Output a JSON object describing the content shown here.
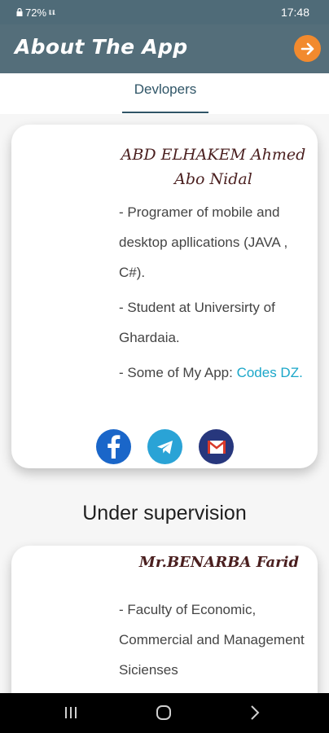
{
  "status_bar": {
    "battery": "72%",
    "signal": "lᵢl. lᵢl.",
    "time": "17:48"
  },
  "app_bar": {
    "title": "About The App",
    "next_icon": "arrow-right-icon"
  },
  "tabs": [
    {
      "label": "Devlopers",
      "selected": true
    }
  ],
  "developer": {
    "name_line1": "ABD ELHAKEM Ahmed",
    "name_line2": "Abo Nidal",
    "bullets": [
      "- Programer of mobile and desktop apllications (JAVA , C#).",
      "- Student at Universirty of Ghardaia."
    ],
    "app_prefix": "- Some of My App: ",
    "app_link": "Codes DZ.",
    "socials": [
      {
        "name": "facebook",
        "icon": "facebook-icon",
        "color": "#1a66c9"
      },
      {
        "name": "telegram",
        "icon": "telegram-icon",
        "color": "#2aa3d6"
      },
      {
        "name": "gmail",
        "icon": "mail-icon",
        "color": "#27377d"
      }
    ]
  },
  "supervision": {
    "title": "Under supervision",
    "name": "Mr.BENARBA Farid",
    "bullets": [
      "- Faculty of Economic, Commercial and Management Sicienses"
    ]
  },
  "colors": {
    "app_bar": "#546e7a",
    "accent": "#f28a2e",
    "link": "#1ba7c9",
    "name": "#4a1f1f"
  }
}
